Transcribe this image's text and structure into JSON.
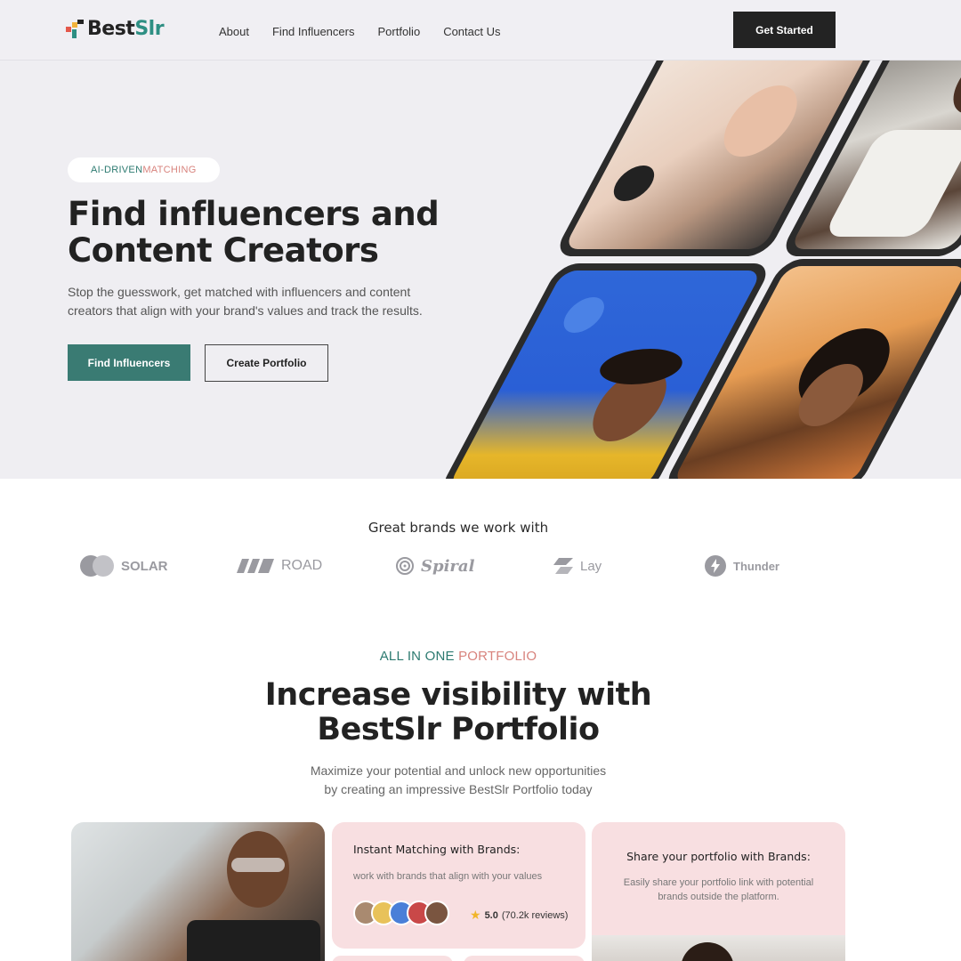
{
  "nav": {
    "logo_part1": "Best",
    "logo_part2": "Slr",
    "links": [
      "About",
      "Find Influencers",
      "Portfolio",
      "Contact Us"
    ],
    "cta": "Get Started"
  },
  "hero": {
    "pill_part1": "AI-DRIVEN ",
    "pill_part2": "MATCHING",
    "title_line1": "Find influencers and",
    "title_line2": "Content Creators",
    "subtitle": "Stop the guesswork, get matched with influencers and content creators that align with your brand's values and track the results.",
    "primary_button": "Find Influencers",
    "secondary_button": "Create Portfolio"
  },
  "brands": {
    "title": "Great brands we work with",
    "items": [
      "SOLAR",
      "ROAD",
      "Spiral",
      "Lay",
      "Thunder"
    ]
  },
  "portfolio": {
    "eyebrow_part1": "ALL IN ONE ",
    "eyebrow_part2": "PORTFOLIO",
    "title_line1": "Increase visibility with",
    "title_line2": "BestSlr Portfolio",
    "sub_line1": "Maximize your potential and unlock new opportunities",
    "sub_line2": "by creating an impressive BestSlr Portfolio today",
    "card1": {
      "title": "Instant Matching with Brands:",
      "text": "work with brands that align with your values",
      "rating": "5.0",
      "reviews": "(70.2k reviews)"
    },
    "card2": {
      "title": "Share your portfolio with Brands:",
      "text_line1": "Easily share your portfolio link with potential",
      "text_line2": "brands outside the platform."
    }
  },
  "colors": {
    "accent": "#3a7b73",
    "coral": "#d8837d",
    "dark": "#232323",
    "card_pink": "#f8dfe1"
  }
}
